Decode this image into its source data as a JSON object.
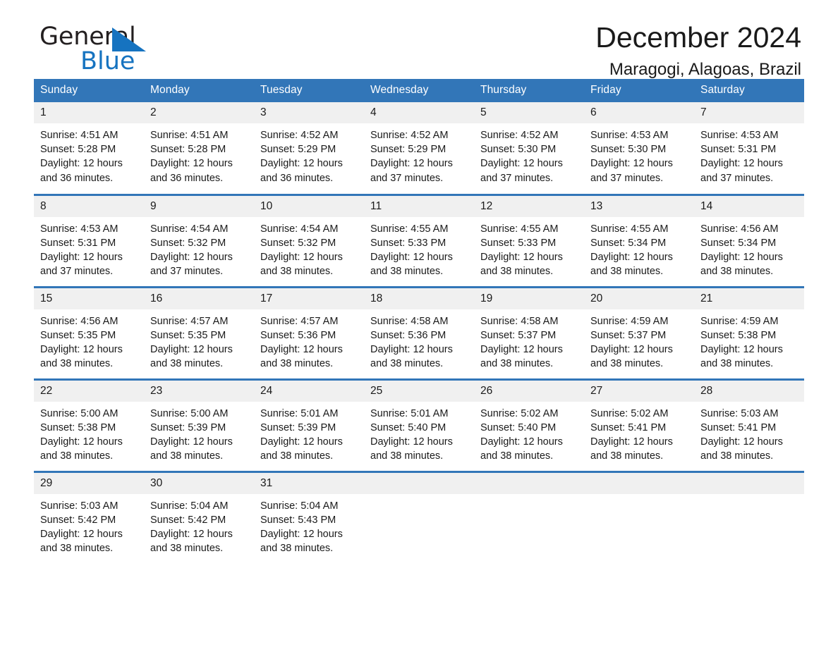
{
  "brand": {
    "name_part1": "General",
    "name_part2": "Blue",
    "flag_color": "#1673c0"
  },
  "header": {
    "title": "December 2024",
    "subtitle": "Maragogi, Alagoas, Brazil"
  },
  "theme": {
    "header_blue": "#3276b8",
    "daynum_bg": "#f0f0f0",
    "text": "#1a1a1a"
  },
  "weekdays": [
    "Sunday",
    "Monday",
    "Tuesday",
    "Wednesday",
    "Thursday",
    "Friday",
    "Saturday"
  ],
  "weeks": [
    [
      {
        "day": "1",
        "sunrise": "Sunrise: 4:51 AM",
        "sunset": "Sunset: 5:28 PM",
        "daylight": "Daylight: 12 hours and 36 minutes."
      },
      {
        "day": "2",
        "sunrise": "Sunrise: 4:51 AM",
        "sunset": "Sunset: 5:28 PM",
        "daylight": "Daylight: 12 hours and 36 minutes."
      },
      {
        "day": "3",
        "sunrise": "Sunrise: 4:52 AM",
        "sunset": "Sunset: 5:29 PM",
        "daylight": "Daylight: 12 hours and 36 minutes."
      },
      {
        "day": "4",
        "sunrise": "Sunrise: 4:52 AM",
        "sunset": "Sunset: 5:29 PM",
        "daylight": "Daylight: 12 hours and 37 minutes."
      },
      {
        "day": "5",
        "sunrise": "Sunrise: 4:52 AM",
        "sunset": "Sunset: 5:30 PM",
        "daylight": "Daylight: 12 hours and 37 minutes."
      },
      {
        "day": "6",
        "sunrise": "Sunrise: 4:53 AM",
        "sunset": "Sunset: 5:30 PM",
        "daylight": "Daylight: 12 hours and 37 minutes."
      },
      {
        "day": "7",
        "sunrise": "Sunrise: 4:53 AM",
        "sunset": "Sunset: 5:31 PM",
        "daylight": "Daylight: 12 hours and 37 minutes."
      }
    ],
    [
      {
        "day": "8",
        "sunrise": "Sunrise: 4:53 AM",
        "sunset": "Sunset: 5:31 PM",
        "daylight": "Daylight: 12 hours and 37 minutes."
      },
      {
        "day": "9",
        "sunrise": "Sunrise: 4:54 AM",
        "sunset": "Sunset: 5:32 PM",
        "daylight": "Daylight: 12 hours and 37 minutes."
      },
      {
        "day": "10",
        "sunrise": "Sunrise: 4:54 AM",
        "sunset": "Sunset: 5:32 PM",
        "daylight": "Daylight: 12 hours and 38 minutes."
      },
      {
        "day": "11",
        "sunrise": "Sunrise: 4:55 AM",
        "sunset": "Sunset: 5:33 PM",
        "daylight": "Daylight: 12 hours and 38 minutes."
      },
      {
        "day": "12",
        "sunrise": "Sunrise: 4:55 AM",
        "sunset": "Sunset: 5:33 PM",
        "daylight": "Daylight: 12 hours and 38 minutes."
      },
      {
        "day": "13",
        "sunrise": "Sunrise: 4:55 AM",
        "sunset": "Sunset: 5:34 PM",
        "daylight": "Daylight: 12 hours and 38 minutes."
      },
      {
        "day": "14",
        "sunrise": "Sunrise: 4:56 AM",
        "sunset": "Sunset: 5:34 PM",
        "daylight": "Daylight: 12 hours and 38 minutes."
      }
    ],
    [
      {
        "day": "15",
        "sunrise": "Sunrise: 4:56 AM",
        "sunset": "Sunset: 5:35 PM",
        "daylight": "Daylight: 12 hours and 38 minutes."
      },
      {
        "day": "16",
        "sunrise": "Sunrise: 4:57 AM",
        "sunset": "Sunset: 5:35 PM",
        "daylight": "Daylight: 12 hours and 38 minutes."
      },
      {
        "day": "17",
        "sunrise": "Sunrise: 4:57 AM",
        "sunset": "Sunset: 5:36 PM",
        "daylight": "Daylight: 12 hours and 38 minutes."
      },
      {
        "day": "18",
        "sunrise": "Sunrise: 4:58 AM",
        "sunset": "Sunset: 5:36 PM",
        "daylight": "Daylight: 12 hours and 38 minutes."
      },
      {
        "day": "19",
        "sunrise": "Sunrise: 4:58 AM",
        "sunset": "Sunset: 5:37 PM",
        "daylight": "Daylight: 12 hours and 38 minutes."
      },
      {
        "day": "20",
        "sunrise": "Sunrise: 4:59 AM",
        "sunset": "Sunset: 5:37 PM",
        "daylight": "Daylight: 12 hours and 38 minutes."
      },
      {
        "day": "21",
        "sunrise": "Sunrise: 4:59 AM",
        "sunset": "Sunset: 5:38 PM",
        "daylight": "Daylight: 12 hours and 38 minutes."
      }
    ],
    [
      {
        "day": "22",
        "sunrise": "Sunrise: 5:00 AM",
        "sunset": "Sunset: 5:38 PM",
        "daylight": "Daylight: 12 hours and 38 minutes."
      },
      {
        "day": "23",
        "sunrise": "Sunrise: 5:00 AM",
        "sunset": "Sunset: 5:39 PM",
        "daylight": "Daylight: 12 hours and 38 minutes."
      },
      {
        "day": "24",
        "sunrise": "Sunrise: 5:01 AM",
        "sunset": "Sunset: 5:39 PM",
        "daylight": "Daylight: 12 hours and 38 minutes."
      },
      {
        "day": "25",
        "sunrise": "Sunrise: 5:01 AM",
        "sunset": "Sunset: 5:40 PM",
        "daylight": "Daylight: 12 hours and 38 minutes."
      },
      {
        "day": "26",
        "sunrise": "Sunrise: 5:02 AM",
        "sunset": "Sunset: 5:40 PM",
        "daylight": "Daylight: 12 hours and 38 minutes."
      },
      {
        "day": "27",
        "sunrise": "Sunrise: 5:02 AM",
        "sunset": "Sunset: 5:41 PM",
        "daylight": "Daylight: 12 hours and 38 minutes."
      },
      {
        "day": "28",
        "sunrise": "Sunrise: 5:03 AM",
        "sunset": "Sunset: 5:41 PM",
        "daylight": "Daylight: 12 hours and 38 minutes."
      }
    ],
    [
      {
        "day": "29",
        "sunrise": "Sunrise: 5:03 AM",
        "sunset": "Sunset: 5:42 PM",
        "daylight": "Daylight: 12 hours and 38 minutes."
      },
      {
        "day": "30",
        "sunrise": "Sunrise: 5:04 AM",
        "sunset": "Sunset: 5:42 PM",
        "daylight": "Daylight: 12 hours and 38 minutes."
      },
      {
        "day": "31",
        "sunrise": "Sunrise: 5:04 AM",
        "sunset": "Sunset: 5:43 PM",
        "daylight": "Daylight: 12 hours and 38 minutes."
      },
      {
        "day": "",
        "sunrise": "",
        "sunset": "",
        "daylight": ""
      },
      {
        "day": "",
        "sunrise": "",
        "sunset": "",
        "daylight": ""
      },
      {
        "day": "",
        "sunrise": "",
        "sunset": "",
        "daylight": ""
      },
      {
        "day": "",
        "sunrise": "",
        "sunset": "",
        "daylight": ""
      }
    ]
  ]
}
